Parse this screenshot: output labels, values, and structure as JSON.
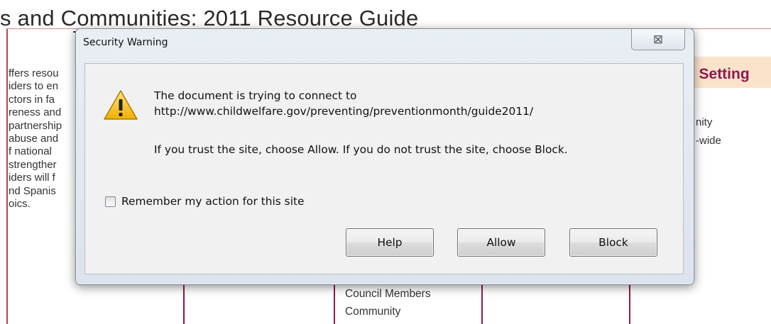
{
  "background": {
    "title": "s and Communities: 2011 Resource Guide",
    "paragraph_lines": [
      "ffers resou",
      "iders to en",
      "ctors in fa",
      "reness and",
      "partnership",
      "abuse and",
      "f national",
      "strengther",
      "iders will f",
      "nd Spanis",
      "oics."
    ],
    "column_header": "m Setting",
    "right_column_lines": [
      "nity",
      "-wide"
    ],
    "bottom_list": [
      "Council Members",
      "Community"
    ]
  },
  "dialog": {
    "title": "Security Warning",
    "close_symbol": "⊠",
    "message_line1": "The document is trying to connect to",
    "message_url": "http://www.childwelfare.gov/preventing/preventionmonth/guide2011/",
    "message_line2": "If you trust the site, choose Allow. If you do not trust the site, choose Block.",
    "remember_label": "Remember my action for this site",
    "remember_checked": false,
    "buttons": {
      "help": "Help",
      "allow": "Allow",
      "block": "Block"
    },
    "icon": "warning-triangle-icon"
  }
}
